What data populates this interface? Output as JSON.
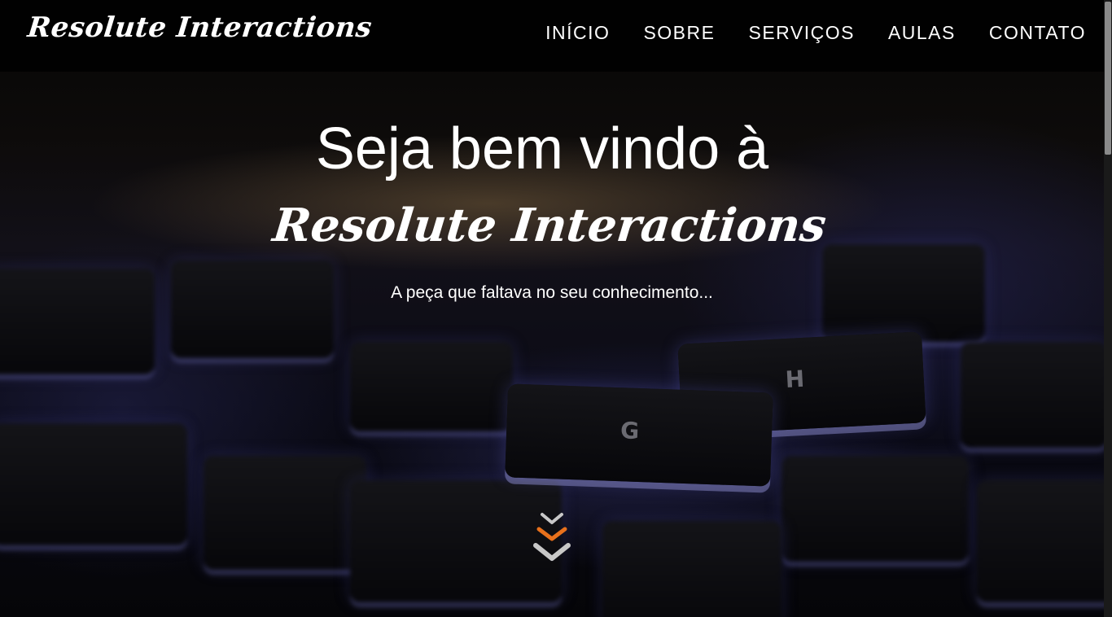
{
  "site": {
    "brand": "Resolute Interactions"
  },
  "nav": {
    "items": [
      {
        "label": "INÍCIO"
      },
      {
        "label": "SOBRE"
      },
      {
        "label": "SERVIÇOS"
      },
      {
        "label": "AULAS"
      },
      {
        "label": "CONTATO"
      }
    ]
  },
  "hero": {
    "headline": "Seja bem vindo à",
    "headline_brand": "Resolute Interactions",
    "tagline": "A peça que faltava no seu conhecimento...",
    "scroll_icon": "chevrons-down-icon",
    "keys": [
      "G",
      "H"
    ]
  },
  "colors": {
    "accent": "#e8711c",
    "chevron_gray": "#c8c8c8",
    "navbar_bg": "#000000"
  }
}
